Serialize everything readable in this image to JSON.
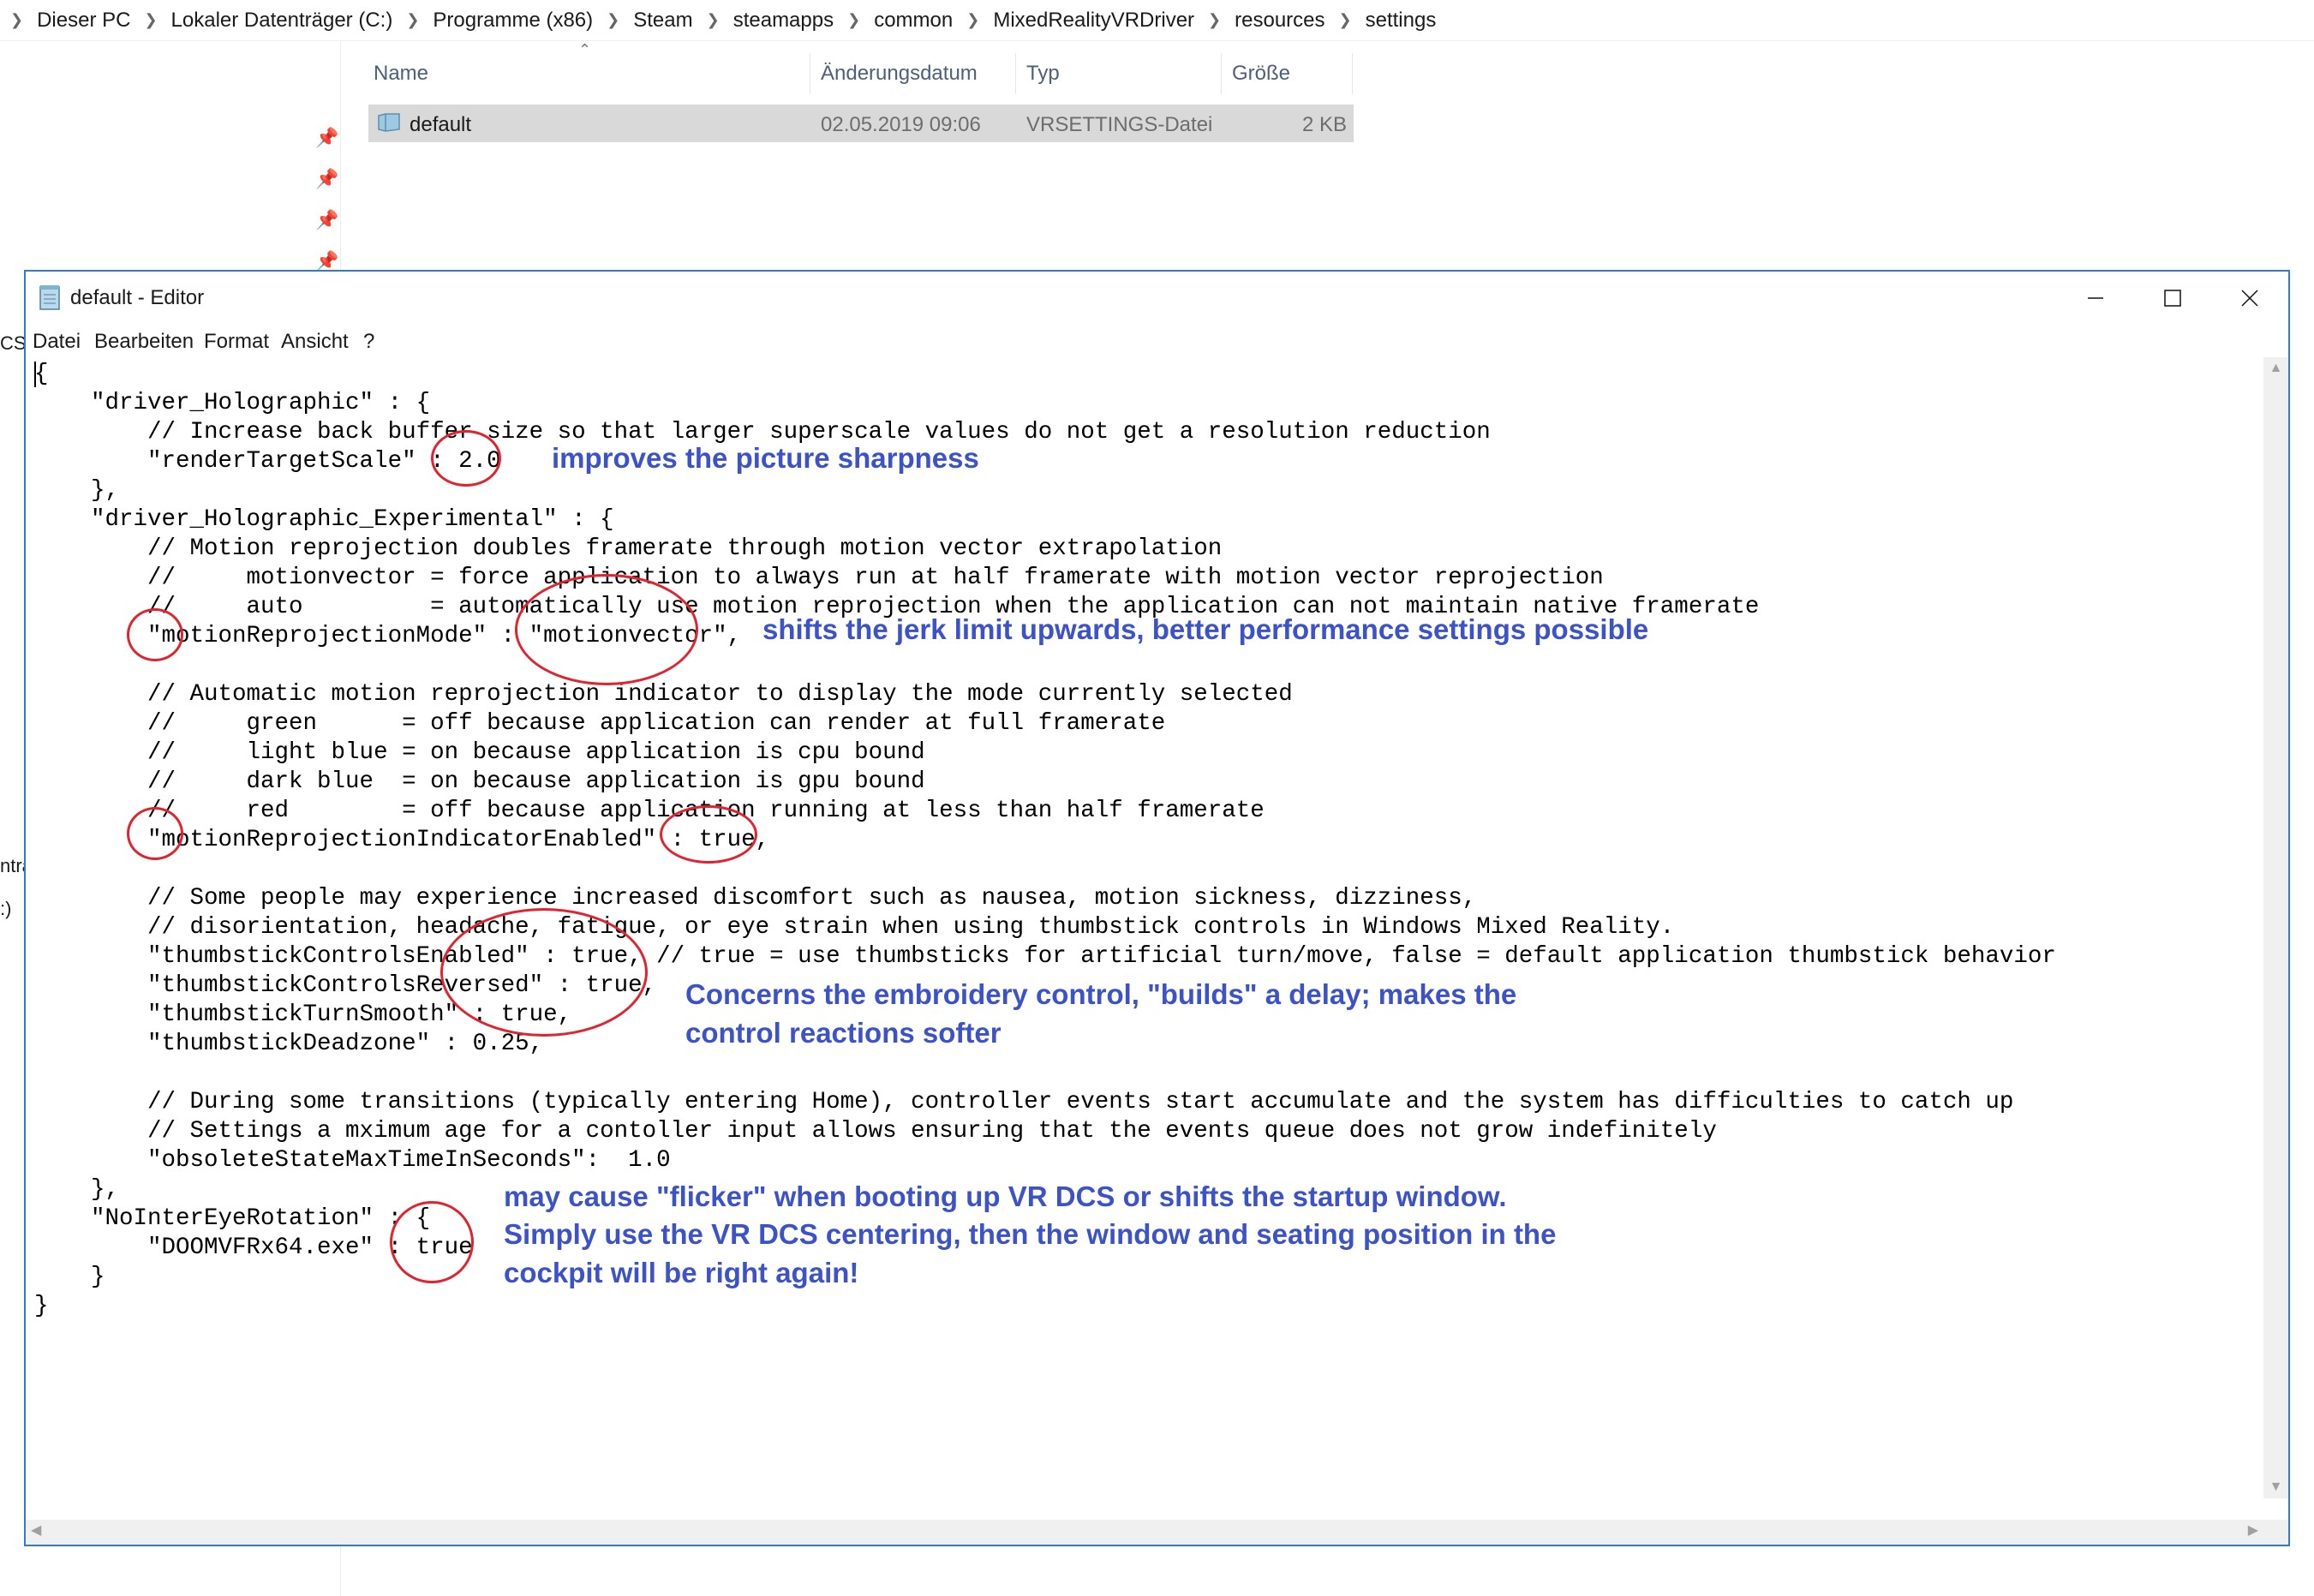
{
  "explorer": {
    "breadcrumb": [
      "Dieser PC",
      "Lokaler Datenträger (C:)",
      "Programme (x86)",
      "Steam",
      "steamapps",
      "common",
      "MixedRealityVRDriver",
      "resources",
      "settings"
    ],
    "columns": {
      "name": "Name",
      "date": "Änderungsdatum",
      "type": "Typ",
      "size": "Größe"
    },
    "file": {
      "name": "default",
      "date": "02.05.2019 09:06",
      "type": "VRSETTINGS-Datei",
      "size": "2 KB"
    },
    "left_fragments": [
      "CS",
      "nträ",
      ":)"
    ]
  },
  "editor": {
    "title": "default - Editor",
    "menu": [
      "Datei",
      "Bearbeiten",
      "Format",
      "Ansicht",
      "?"
    ],
    "lines": [
      "{",
      "    \"driver_Holographic\" : {",
      "        // Increase back buffer size so that larger superscale values do not get a resolution reduction",
      "        \"renderTargetScale\" : 2.0",
      "    },",
      "    \"driver_Holographic_Experimental\" : {",
      "        // Motion reprojection doubles framerate through motion vector extrapolation",
      "        //     motionvector = force application to always run at half framerate with motion vector reprojection",
      "        //     auto         = automatically use motion reprojection when the application can not maintain native framerate",
      "        \"motionReprojectionMode\" : \"motionvector\",",
      "",
      "        // Automatic motion reprojection indicator to display the mode currently selected",
      "        //     green      = off because application can render at full framerate",
      "        //     light blue = on because application is cpu bound",
      "        //     dark blue  = on because application is gpu bound",
      "        //     red        = off because application running at less than half framerate",
      "        \"motionReprojectionIndicatorEnabled\" : true,",
      "",
      "        // Some people may experience increased discomfort such as nausea, motion sickness, dizziness,",
      "        // disorientation, headache, fatigue, or eye strain when using thumbstick controls in Windows Mixed Reality.",
      "        \"thumbstickControlsEnabled\" : true, // true = use thumbsticks for artificial turn/move, false = default application thumbstick behavior",
      "        \"thumbstickControlsReversed\" : true,",
      "        \"thumbstickTurnSmooth\" : true,",
      "        \"thumbstickDeadzone\" : 0.25,",
      "",
      "        // During some transitions (typically entering Home), controller events start accumulate and the system has difficulties to catch up",
      "        // Settings a mximum age for a contoller input allows ensuring that the events queue does not grow indefinitely",
      "        \"obsoleteStateMaxTimeInSeconds\":  1.0",
      "    },",
      "    \"NoInterEyeRotation\" : {",
      "        \"DOOMVFRx64.exe\" : true",
      "    }",
      "}"
    ]
  },
  "annotations": {
    "sharpness": "improves the picture sharpness",
    "jerk": "shifts the jerk limit upwards, better performance settings possible",
    "thumbstick_1": "Concerns the embroidery control, \"builds\" a delay; makes the",
    "thumbstick_2": "control reactions softer",
    "flicker_1": "may cause \"flicker\" when booting up VR DCS or shifts the startup window.",
    "flicker_2": "Simply use the VR DCS centering, then the window and seating position in the",
    "flicker_3": "cockpit will be right again!"
  },
  "colors": {
    "annotation_text": "#3c52c9",
    "annotation_ring": "#e0232e",
    "window_border": "#2c7cd3",
    "selected_row": "#d9d9d9"
  }
}
